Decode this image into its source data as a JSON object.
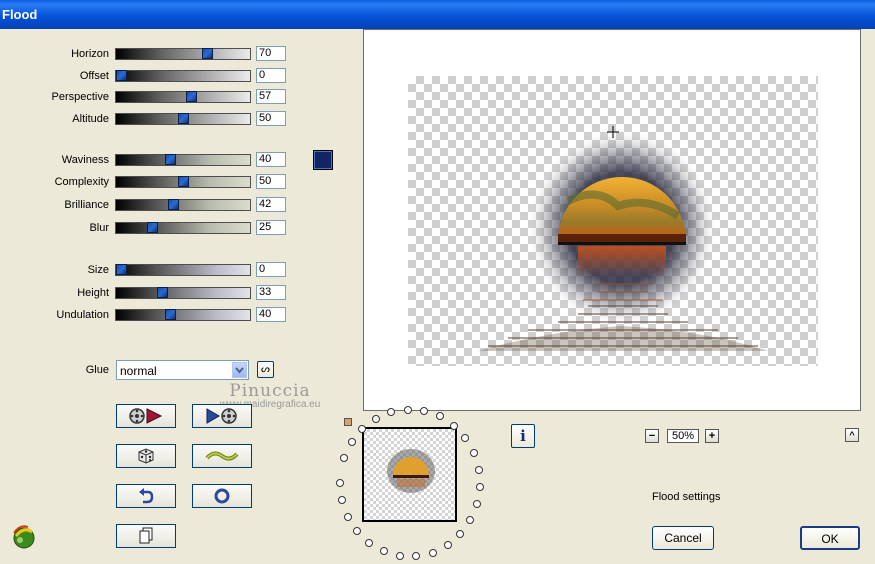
{
  "window": {
    "title": "Flood"
  },
  "sliders": {
    "horizon": {
      "label": "Horizon",
      "value": "70",
      "level": 0.7
    },
    "offset": {
      "label": "Offset",
      "value": "0",
      "level": 0.0
    },
    "perspective": {
      "label": "Perspective",
      "value": "57",
      "level": 0.57
    },
    "altitude": {
      "label": "Altitude",
      "value": "50",
      "level": 0.5
    },
    "waviness": {
      "label": "Waviness",
      "value": "40",
      "level": 0.4
    },
    "complexity": {
      "label": "Complexity",
      "value": "50",
      "level": 0.5
    },
    "brilliance": {
      "label": "Brilliance",
      "value": "42",
      "level": 0.42
    },
    "blur": {
      "label": "Blur",
      "value": "25",
      "level": 0.25
    },
    "size": {
      "label": "Size",
      "value": "0",
      "level": 0.0
    },
    "height": {
      "label": "Height",
      "value": "33",
      "level": 0.33
    },
    "undulation": {
      "label": "Undulation",
      "value": "40",
      "level": 0.4
    }
  },
  "color_swatch": "#0f2565",
  "glue": {
    "label": "Glue",
    "selected": "normal"
  },
  "toggle_button_label": "ᔕ",
  "watermark": {
    "line1": "Pinuccia",
    "line2": "www.maidiregrafica.eu"
  },
  "zoom": {
    "value": "50%",
    "minus": "−",
    "plus": "+"
  },
  "status_text": "Flood settings",
  "buttons": {
    "cancel": "Cancel",
    "ok": "OK",
    "info": "i",
    "collapse": "^"
  },
  "icons": [
    "film-reverse-icon",
    "film-forward-icon",
    "dice-icon",
    "wave-icon",
    "undo-icon",
    "reset-icon",
    "copy-icon",
    "app-logo-icon"
  ]
}
